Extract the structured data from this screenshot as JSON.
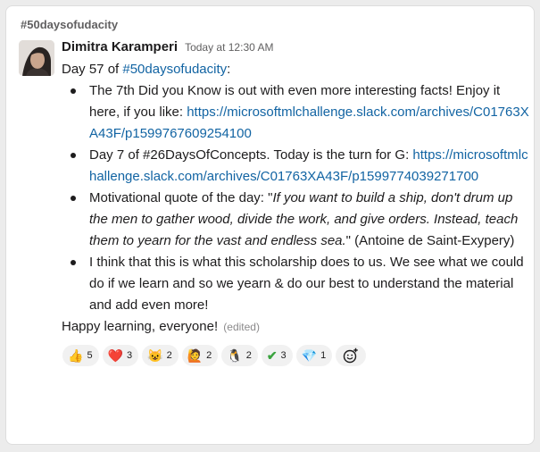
{
  "channel": "#50daysofudacity",
  "message": {
    "author": "Dimitra Karamperi",
    "time": "Today at 12:30 AM",
    "intro_prefix": "Day 57 of ",
    "intro_tag": "#50daysofudacity",
    "intro_suffix": ":",
    "bullet1_text": "The 7th Did you Know is out with even more interesting facts! Enjoy it here, if you like: ",
    "bullet1_url": "https://microsoftmlchallenge.slack.com/archives/C01763XA43F/p1599767609254100",
    "bullet2_text": "Day 7 of #26DaysOfConcepts. Today is the turn for G: ",
    "bullet2_url": "https://microsoftmlchallenge.slack.com/archives/C01763XA43F/p1599774039271700",
    "bullet3_prefix": "Motivational quote of the day: \"",
    "bullet3_quote": "If you want to build a ship, don't drum up the men to gather wood, divide the work, and give orders. Instead, teach them to yearn for the vast and endless sea.",
    "bullet3_suffix": "\" (Antoine de Saint-Exypery)",
    "bullet4_text": "I think that this is what this scholarship does to us. We see what we could do if we learn and so we yearn & do our best to understand the material and add even more!",
    "closing": "Happy learning, everyone!",
    "edited": "(edited)"
  },
  "reactions": [
    {
      "icon": "thumbs-up-icon",
      "emoji": "👍",
      "count": "5"
    },
    {
      "icon": "heart-icon",
      "emoji": "❤️",
      "count": "3"
    },
    {
      "icon": "smiley-icon",
      "emoji": "😺",
      "count": "2"
    },
    {
      "icon": "raised-hand-icon",
      "emoji": "🙋",
      "count": "2"
    },
    {
      "icon": "penguin-icon",
      "emoji": "🐧",
      "count": "2"
    },
    {
      "icon": "check-mark-icon",
      "emoji": "✔",
      "count": "3"
    },
    {
      "icon": "gem-icon",
      "emoji": "💎",
      "count": "1"
    }
  ],
  "colors": {
    "link": "#1264a3",
    "text": "#1d1c1d",
    "muted": "#616061",
    "check": "#3aa33e",
    "heart": "#d2232a"
  }
}
